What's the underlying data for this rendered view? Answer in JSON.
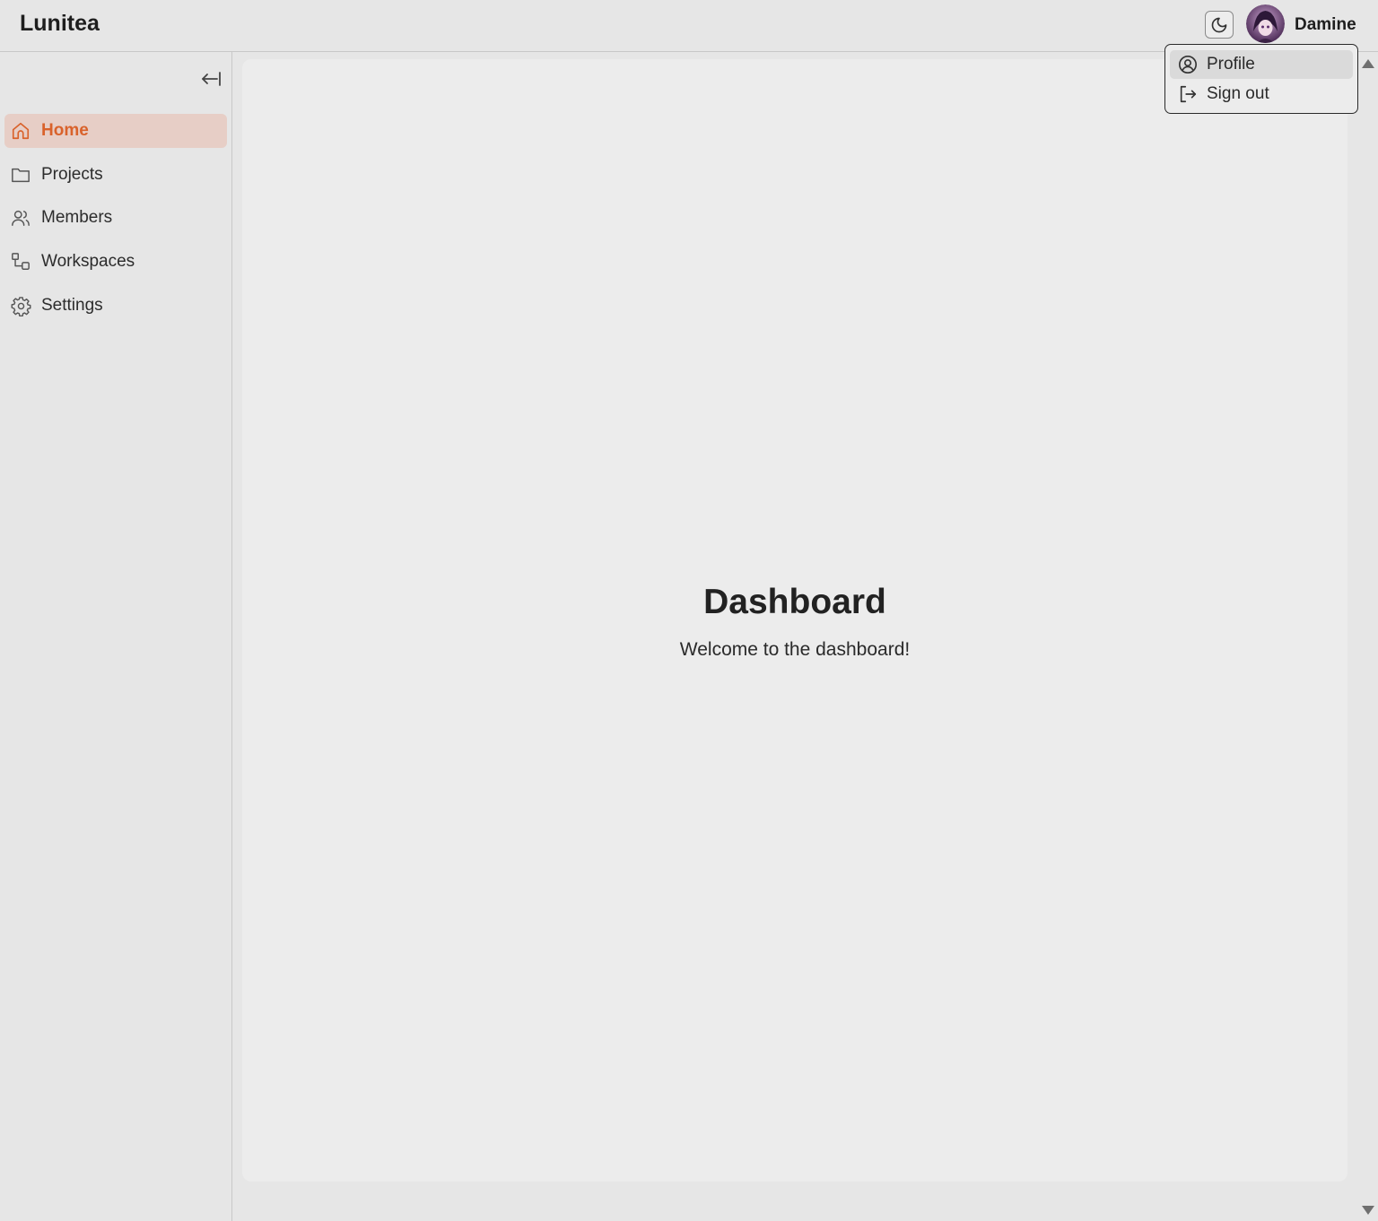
{
  "header": {
    "app_title": "Lunitea",
    "user_name": "Damine",
    "theme_icon": "moon-icon"
  },
  "sidebar": {
    "collapse_icon": "collapse-left-icon",
    "items": [
      {
        "label": "Home",
        "icon": "home-icon",
        "active": true
      },
      {
        "label": "Projects",
        "icon": "folder-icon",
        "active": false
      },
      {
        "label": "Members",
        "icon": "users-icon",
        "active": false
      },
      {
        "label": "Workspaces",
        "icon": "workspaces-icon",
        "active": false
      },
      {
        "label": "Settings",
        "icon": "gear-icon",
        "active": false
      }
    ]
  },
  "main": {
    "title": "Dashboard",
    "subtitle": "Welcome to the dashboard!"
  },
  "user_menu": {
    "items": [
      {
        "label": "Profile",
        "icon": "user-circle-icon"
      },
      {
        "label": "Sign out",
        "icon": "sign-out-icon"
      }
    ]
  },
  "colors": {
    "accent": "#d9622b",
    "active_bg": "#e7cec6"
  }
}
